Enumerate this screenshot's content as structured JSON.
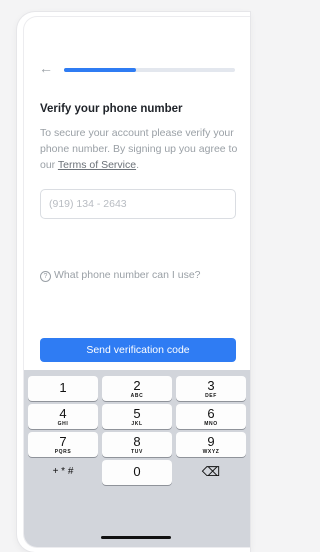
{
  "header": {
    "back_icon": "←",
    "progress_fraction": 0.42
  },
  "title": "Verify your phone number",
  "description": {
    "text": "To secure your account please verify your phone number. By signing up you agree to our ",
    "terms_link": "Terms of Service",
    "end": "."
  },
  "phone_input": {
    "placeholder": "(919) 134 - 2643",
    "value": ""
  },
  "help": {
    "icon": "?",
    "label": "What phone number can I use?"
  },
  "send_button": {
    "label": "Send verification code",
    "color": "#2f7cf3"
  },
  "keypad": {
    "keys": [
      {
        "num": "1",
        "letters": ""
      },
      {
        "num": "2",
        "letters": "ABC"
      },
      {
        "num": "3",
        "letters": "DEF"
      },
      {
        "num": "4",
        "letters": "GHI"
      },
      {
        "num": "5",
        "letters": "JKL"
      },
      {
        "num": "6",
        "letters": "MNO"
      },
      {
        "num": "7",
        "letters": "PQRS"
      },
      {
        "num": "8",
        "letters": "TUV"
      },
      {
        "num": "9",
        "letters": "WXYZ"
      },
      {
        "num": "+ * #",
        "letters": ""
      },
      {
        "num": "0",
        "letters": ""
      },
      {
        "num": "⌫",
        "letters": ""
      }
    ]
  }
}
